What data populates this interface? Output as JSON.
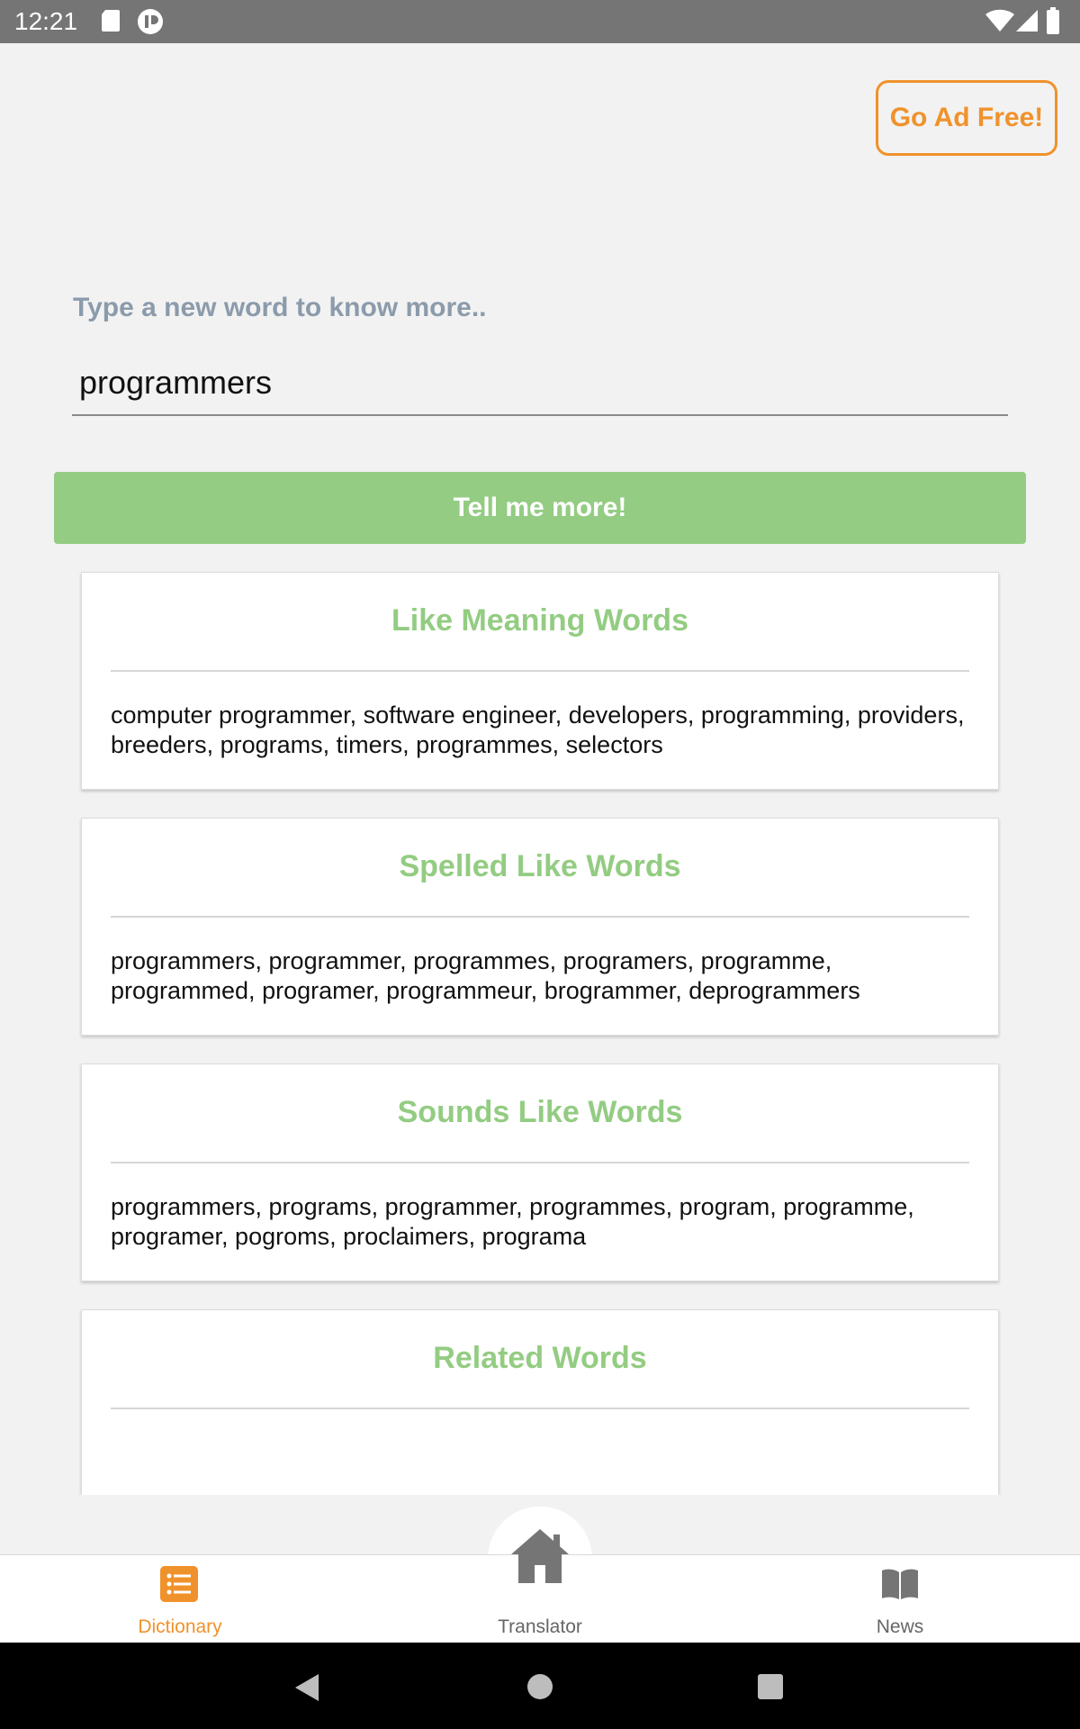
{
  "status_bar": {
    "time": "12:21",
    "icons": [
      "sd-card-icon",
      "app-notification-icon",
      "wifi-icon",
      "signal-icon",
      "battery-icon"
    ]
  },
  "header": {
    "ad_free_label": "Go Ad Free!"
  },
  "search": {
    "label": "Type a new word to know more..",
    "value": "programmers",
    "button_label": "Tell me more!"
  },
  "cards": [
    {
      "title": "Like Meaning Words",
      "body": "computer programmer, software engineer, developers, programming, providers, breeders, programs, timers, programmes, selectors"
    },
    {
      "title": "Spelled Like Words",
      "body": "programmers, programmer, programmes, programers, programme, programmed, programer, programmeur, brogrammer, deprogrammers"
    },
    {
      "title": "Sounds Like Words",
      "body": "programmers, programs, programmer, programmes, program, programme, programer, pogroms, proclaimers, programa"
    },
    {
      "title": "Related Words",
      "body": ""
    }
  ],
  "bottom_nav": {
    "items": [
      {
        "label": "Dictionary",
        "icon": "list-icon",
        "active": true
      },
      {
        "label": "Translator",
        "icon": "home-icon",
        "active": false
      },
      {
        "label": "News",
        "icon": "book-icon",
        "active": false
      }
    ]
  },
  "colors": {
    "accent_orange": "#f0922b",
    "accent_green": "#93cc82",
    "label_gray": "#8b9bab"
  }
}
